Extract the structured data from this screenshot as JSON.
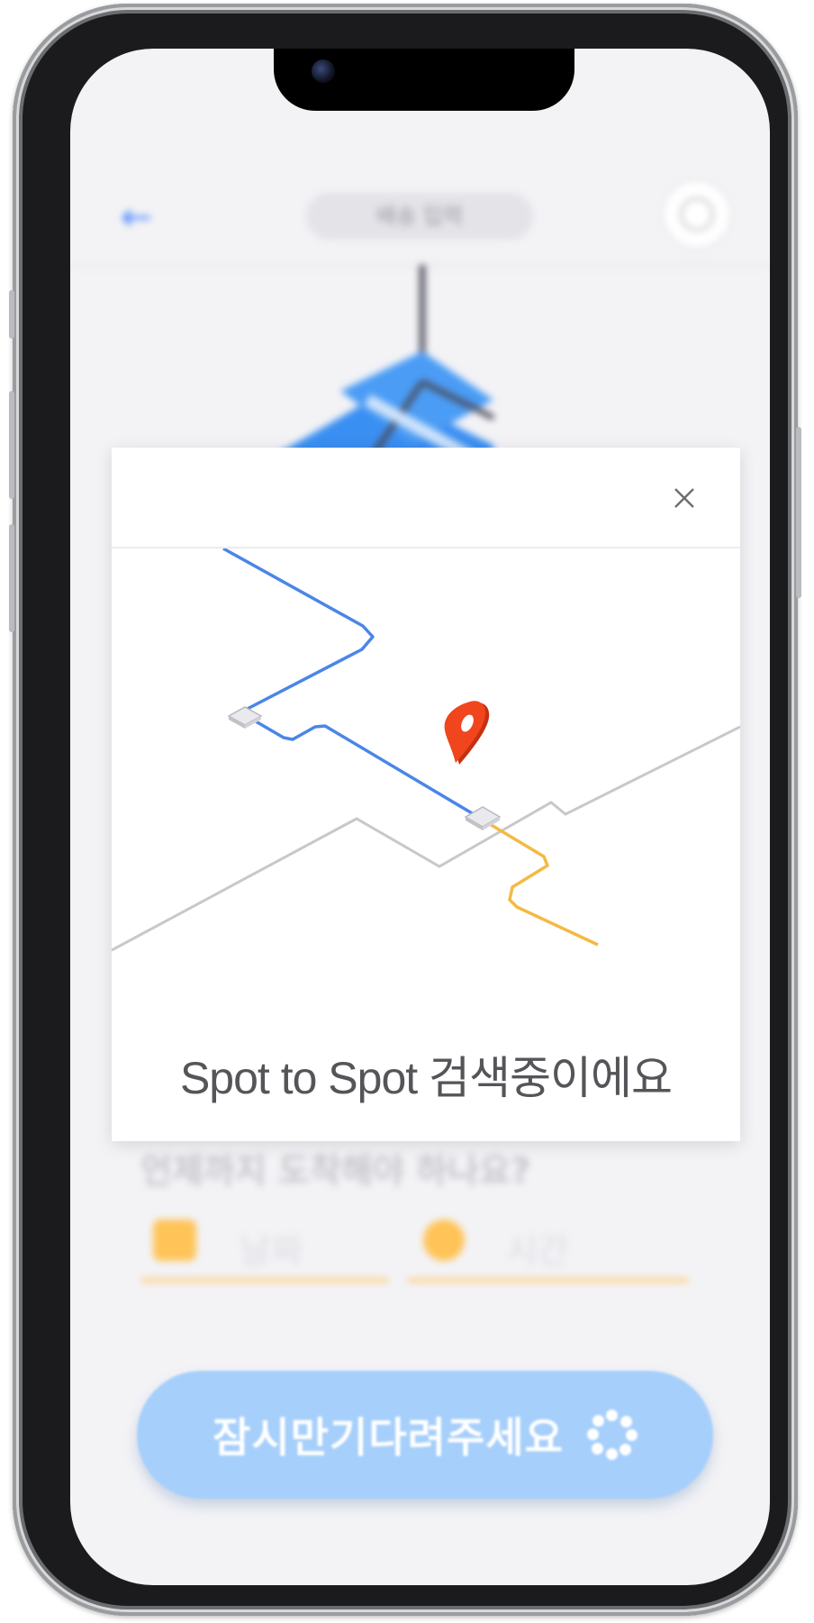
{
  "screen": {
    "title": "배송 입력",
    "deadline_question": "언제까지 도착해야 하나요?",
    "date_field": {
      "label": "날짜",
      "icon": "calendar-icon"
    },
    "time_field": {
      "label": "시간",
      "icon": "clock-icon"
    }
  },
  "modal": {
    "message": "Spot to Spot 검색중이에요",
    "close_icon": "close-icon",
    "illustration": "route-map",
    "colors": {
      "route_blue": "#4a86e8",
      "route_yellow": "#f5b942",
      "road_gray": "#c8c8cc",
      "pin_red": "#e8401c"
    }
  },
  "loading_button": {
    "label": "잠시만기다려주세요",
    "icon": "spinner-icon",
    "color": "#a6cffb"
  },
  "colors": {
    "accent": "#4a86ff",
    "field_accent": "#ffc357"
  }
}
